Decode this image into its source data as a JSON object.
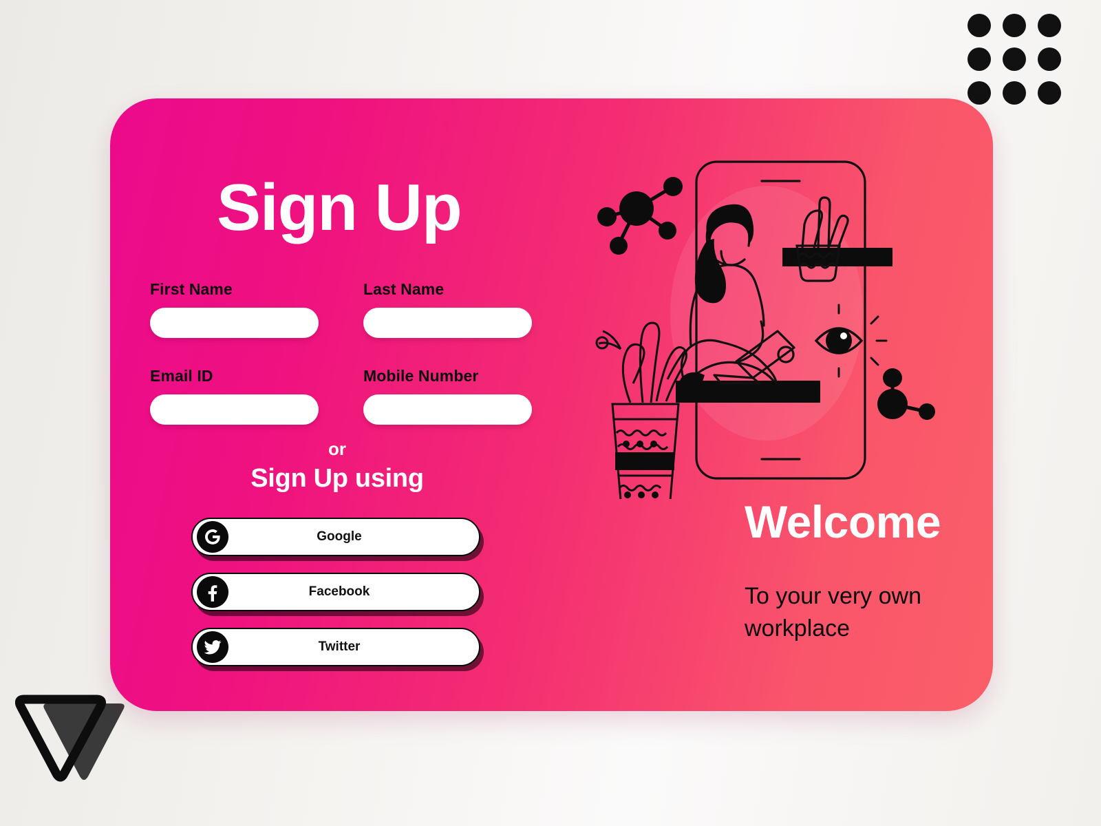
{
  "page": {
    "background_color": "#f3f1ee",
    "card_gradient_from": "#ec0a8c",
    "card_gradient_to": "#fb5f68"
  },
  "decor": {
    "dot_grid": {
      "name": "dot-grid",
      "rows": 3,
      "cols": 3,
      "color": "#111111"
    },
    "logo": {
      "name": "triangle-logo",
      "outline_color": "#111111",
      "fill_color": "#3a3a3a"
    }
  },
  "form": {
    "title": "Sign Up",
    "fields": [
      {
        "label": "First Name",
        "value": "",
        "placeholder": ""
      },
      {
        "label": "Last Name",
        "value": "",
        "placeholder": ""
      },
      {
        "label": "Email ID",
        "value": "",
        "placeholder": ""
      },
      {
        "label": "Mobile Number",
        "value": "",
        "placeholder": ""
      }
    ],
    "or_label": "or",
    "social_heading": "Sign Up using",
    "social_buttons": [
      {
        "label": "Google",
        "icon": "google-icon"
      },
      {
        "label": "Facebook",
        "icon": "facebook-icon"
      },
      {
        "label": "Twitter",
        "icon": "twitter-icon"
      }
    ]
  },
  "hero": {
    "illustration": "woman-working-on-laptop-illustration",
    "heading": "Welcome",
    "subheading": "To your very own workplace",
    "heading_color": "#ffffff",
    "subheading_color": "#0b0b0b"
  }
}
